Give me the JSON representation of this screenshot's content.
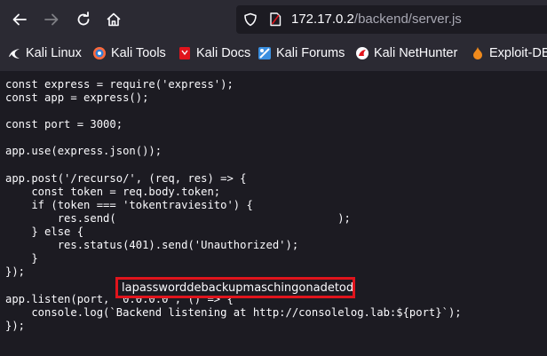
{
  "browser": {
    "url_host": "172.17.0.2",
    "url_path": "/backend/server.js",
    "colors": {
      "chrome_bg": "#2b2a33",
      "page_bg": "#1c1b22",
      "text": "#fbfbfe",
      "highlight_border": "#e0141c"
    }
  },
  "bookmarks": [
    {
      "label": "Kali Linux",
      "icon": "kali-dragon-icon"
    },
    {
      "label": "Kali Tools",
      "icon": "kali-tools-icon"
    },
    {
      "label": "Kali Docs",
      "icon": "kali-docs-icon"
    },
    {
      "label": "Kali Forums",
      "icon": "kali-forums-icon"
    },
    {
      "label": "Kali NetHunter",
      "icon": "kali-nethunter-icon"
    },
    {
      "label": "Exploit-DB",
      "icon": "exploit-db-icon"
    }
  ],
  "code": {
    "lines": [
      "const express = require('express');",
      "const app = express();",
      "",
      "const port = 3000;",
      "",
      "app.use(express.json());",
      "",
      "app.post('/recurso/', (req, res) => {",
      "    const token = req.body.token;",
      "    if (token === 'tokentraviesito') {",
      "        res.send(                                  );",
      "    } else {",
      "        res.status(401).send('Unauthorized');",
      "    }",
      "});",
      "",
      "app.listen(port, '0.0.0.0', () => {",
      "    console.log(`Backend listening at http://consolelog.lab:${port}`);",
      "});"
    ],
    "highlighted_text": "lapassworddebackupmaschingonadetodas"
  }
}
